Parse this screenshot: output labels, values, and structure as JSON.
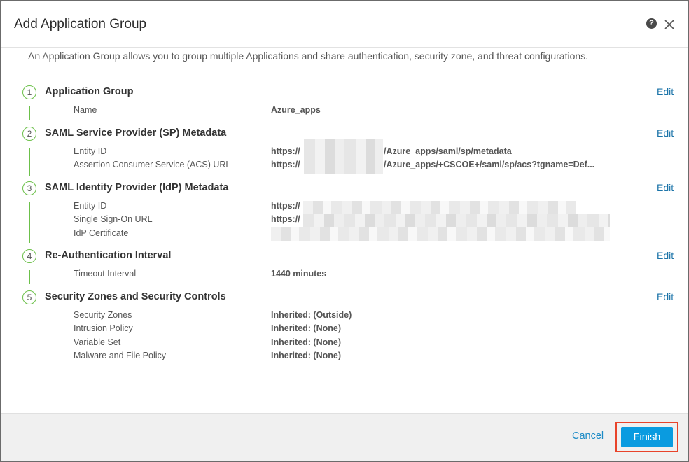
{
  "dialog": {
    "title": "Add Application Group",
    "help_icon": "question-circle-icon",
    "help_glyph": "?",
    "close_icon": "close-icon",
    "description": "An Application Group allows you to group multiple Applications and share authentication, security zone, and threat configurations."
  },
  "steps": [
    {
      "number": "1",
      "title": "Application Group",
      "edit_label": "Edit",
      "fields": [
        {
          "label": "Name",
          "value": "Azure_apps"
        }
      ]
    },
    {
      "number": "2",
      "title": "SAML Service Provider (SP) Metadata",
      "edit_label": "Edit",
      "fields": [
        {
          "label": "Entity ID",
          "value_prefix": "https://",
          "value_suffix": "/Azure_apps/saml/sp/metadata"
        },
        {
          "label": "Assertion Consumer Service (ACS) URL",
          "value_prefix": "https://",
          "value_suffix": "/Azure_apps/+CSCOE+/saml/sp/acs?tgname=Def..."
        }
      ]
    },
    {
      "number": "3",
      "title": "SAML Identity Provider (IdP) Metadata",
      "edit_label": "Edit",
      "fields": [
        {
          "label": "Entity ID",
          "value_prefix": "https://"
        },
        {
          "label": "Single Sign-On URL",
          "value_prefix": "https://"
        },
        {
          "label": "IdP Certificate"
        }
      ]
    },
    {
      "number": "4",
      "title": "Re-Authentication Interval",
      "edit_label": "Edit",
      "fields": [
        {
          "label": "Timeout Interval",
          "value": "1440 minutes"
        }
      ]
    },
    {
      "number": "5",
      "title": "Security Zones and Security Controls",
      "edit_label": "Edit",
      "fields": [
        {
          "label": "Security Zones",
          "value": "Inherited: (Outside)"
        },
        {
          "label": "Intrusion Policy",
          "value": "Inherited: (None)"
        },
        {
          "label": "Variable Set",
          "value": "Inherited: (None)"
        },
        {
          "label": "Malware and File Policy",
          "value": "Inherited: (None)"
        }
      ]
    }
  ],
  "footer": {
    "cancel_label": "Cancel",
    "finish_label": "Finish"
  },
  "colors": {
    "accent": "#0a9be0",
    "step_green": "#6cc04a",
    "highlight": "#e8432a",
    "link": "#1a73a8"
  }
}
